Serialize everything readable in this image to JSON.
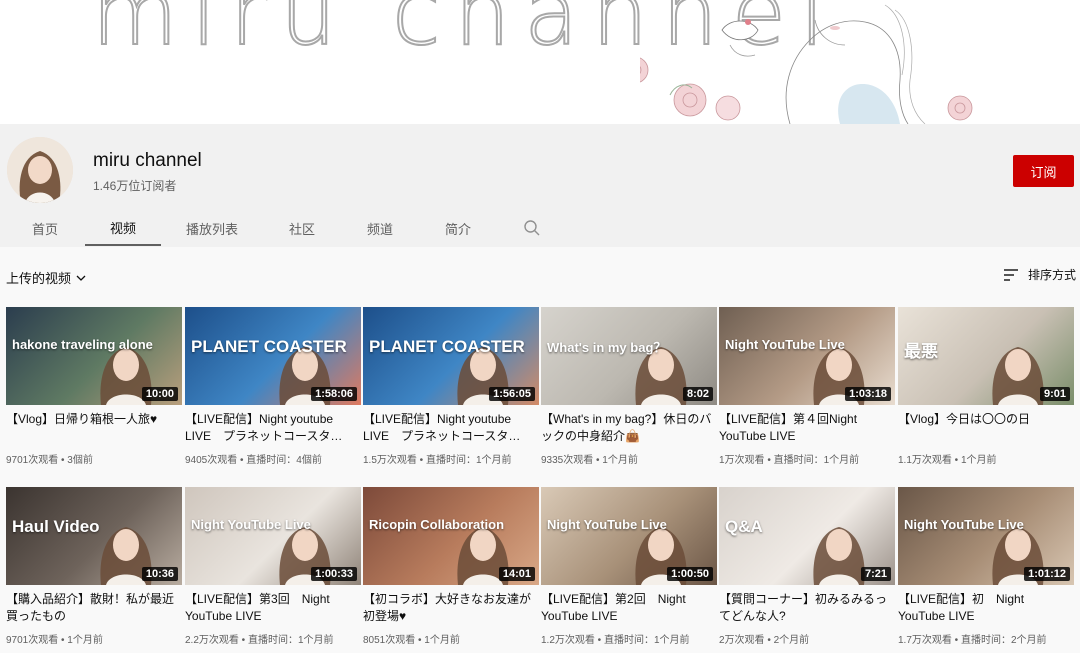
{
  "banner": {
    "title": "miru channel"
  },
  "channel": {
    "name": "miru channel",
    "subscribers": "1.46万位订阅者",
    "subscribe_label": "订阅"
  },
  "tabs": [
    {
      "label": "首页"
    },
    {
      "label": "视频",
      "active": true
    },
    {
      "label": "播放列表"
    },
    {
      "label": "社区"
    },
    {
      "label": "频道"
    },
    {
      "label": "简介"
    }
  ],
  "section": {
    "title": "上传的视频",
    "sort_label": "排序方式"
  },
  "videos": [
    {
      "title": "【Vlog】日帰り箱根一人旅♥",
      "duration": "10:00",
      "meta": "9701次观看 • 3個前",
      "thumb_text": "hakone traveling alone",
      "colors": [
        "#2b3d4e",
        "#5f7a63",
        "#b99f7d"
      ]
    },
    {
      "title": "【LIVE配信】Night youtube LIVE　プラネットコースタ…",
      "duration": "1:58:06",
      "meta": "9405次观看 • 直播时间：4個前",
      "thumb_text": "PLANET COASTER",
      "colors": [
        "#1d4f8a",
        "#3f86c5",
        "#e07a5f"
      ]
    },
    {
      "title": "【LIVE配信】Night youtube LIVE　プラネットコースタ…",
      "duration": "1:56:05",
      "meta": "1.5万次观看 • 直播时间：1个月前",
      "thumb_text": "PLANET COASTER",
      "colors": [
        "#1d4f8a",
        "#3f86c5",
        "#d48b66"
      ]
    },
    {
      "title": "【What's in my bag?】休日のバックの中身紹介👜",
      "duration": "8:02",
      "meta": "9335次观看 • 1个月前",
      "thumb_text": "What's in my bag？",
      "colors": [
        "#d6d3cd",
        "#bcb8b0",
        "#8e8a83"
      ]
    },
    {
      "title": "【LIVE配信】第４回Night YouTube LIVE",
      "duration": "1:03:18",
      "meta": "1万次观看 • 直播时间：1个月前",
      "thumb_text": "Night YouTube Live",
      "colors": [
        "#6f5f52",
        "#b49b86",
        "#e8dccf"
      ]
    },
    {
      "title": "【Vlog】今日は〇〇の日",
      "duration": "9:01",
      "meta": "1.1万次观看 • 1个月前",
      "thumb_text": "最悪",
      "colors": [
        "#e9e2d8",
        "#c9c0b4",
        "#7a8e6a"
      ]
    },
    {
      "title": "【購入品紹介】散財！私が最近買ったもの",
      "duration": "10:36",
      "meta": "9701次观看 • 1个月前",
      "thumb_text": "Haul Video",
      "colors": [
        "#3b3430",
        "#6e635b",
        "#b8aca0"
      ]
    },
    {
      "title": "【LIVE配信】第3回　Night YouTube LIVE",
      "duration": "1:00:33",
      "meta": "2.2万次观看 • 直播时间：1个月前",
      "thumb_text": "Night YouTube Live",
      "colors": [
        "#cfc6bd",
        "#e9e4de",
        "#8f8378"
      ]
    },
    {
      "title": "【初コラボ】大好きなお友達が初登場♥",
      "duration": "14:01",
      "meta": "8051次观看 • 1个月前",
      "thumb_text": "Ricopin Collaboration",
      "colors": [
        "#7d4a3a",
        "#b87c5d",
        "#d9a887"
      ]
    },
    {
      "title": "【LIVE配信】第2回　Night YouTube LIVE",
      "duration": "1:00:50",
      "meta": "1.2万次观看 • 直播时间：1个月前",
      "thumb_text": "Night YouTube Live",
      "colors": [
        "#d9c9b6",
        "#a89179",
        "#6b5646"
      ]
    },
    {
      "title": "【質問コーナー】初みるみるってどんな人?",
      "duration": "7:21",
      "meta": "2万次观看 • 2个月前",
      "thumb_text": "Q&A",
      "colors": [
        "#d8d2cc",
        "#efeae5",
        "#9c928a"
      ]
    },
    {
      "title": "【LIVE配信】初　Night YouTube LIVE",
      "duration": "1:01:12",
      "meta": "1.7万次观看 • 直播时间：2个月前",
      "thumb_text": "Night YouTube Live",
      "colors": [
        "#6a5748",
        "#a88e76",
        "#d8c6b2"
      ]
    }
  ]
}
